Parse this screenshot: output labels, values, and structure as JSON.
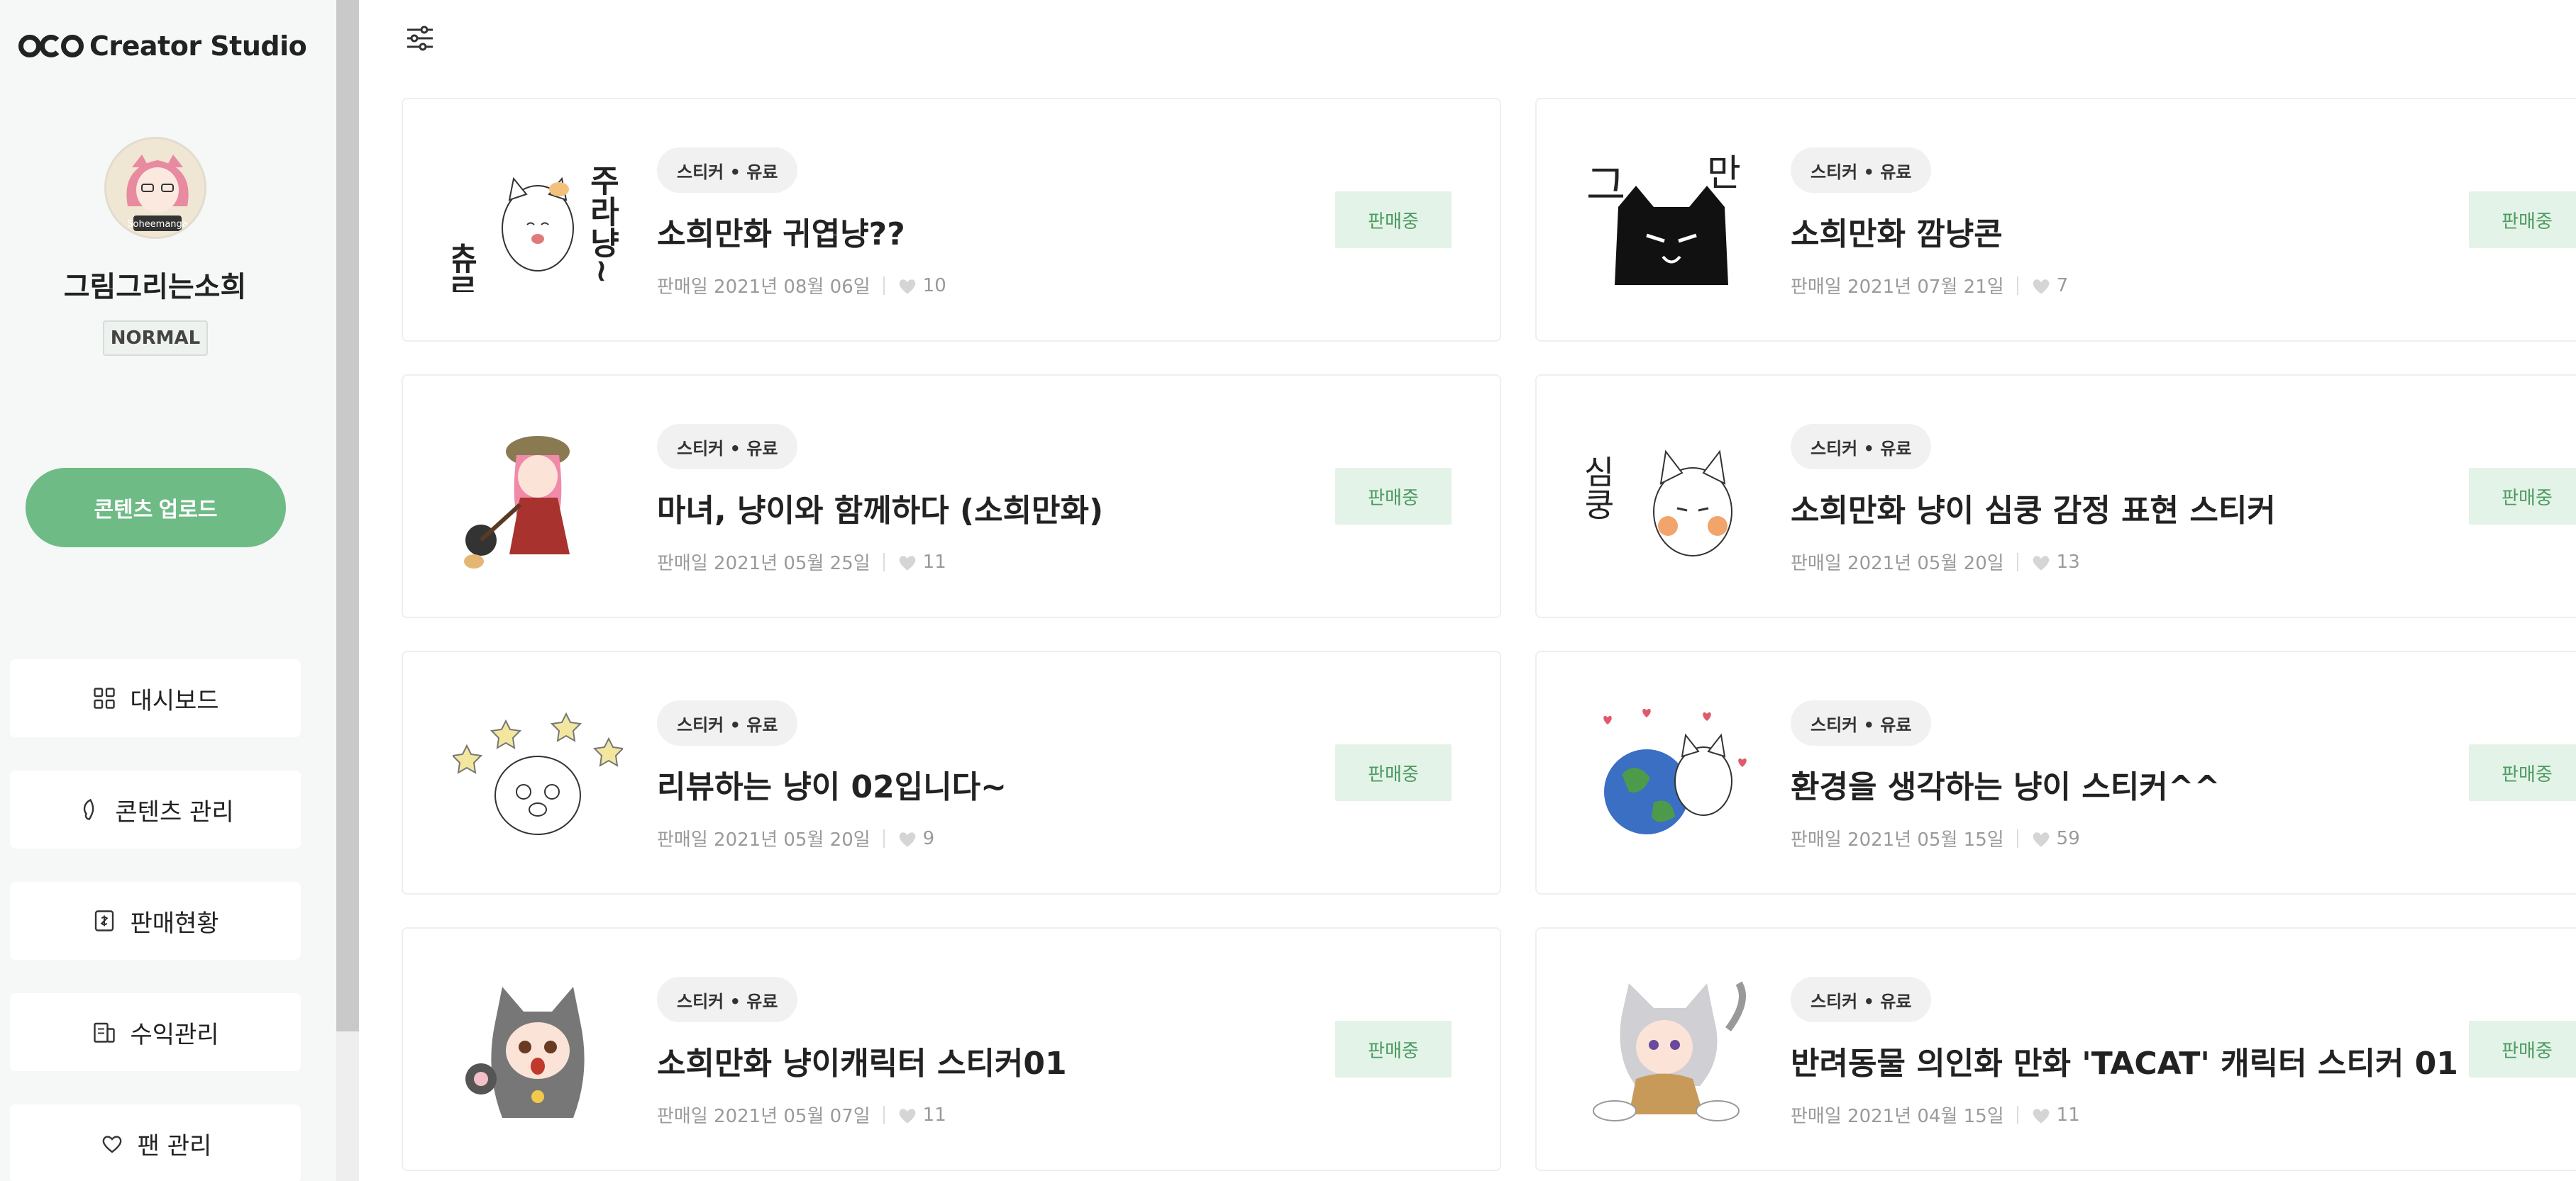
{
  "app": {
    "logo_text": "Creator Studio"
  },
  "profile": {
    "name": "그림그리는소희",
    "tier": "NORMAL",
    "avatar_caption": "Soheemanga"
  },
  "sidebar": {
    "upload_label": "콘텐츠 업로드",
    "items": [
      {
        "label": "대시보드",
        "icon": "grid-icon"
      },
      {
        "label": "콘텐츠 관리",
        "icon": "leaf-icon"
      },
      {
        "label": "판매현황",
        "icon": "sales-icon"
      },
      {
        "label": "수익관리",
        "icon": "ledger-icon"
      },
      {
        "label": "팬 관리",
        "icon": "heart-icon"
      }
    ]
  },
  "cards": [
    {
      "badge": "스티커 • 유료",
      "title": "소희만화 귀엽냥??",
      "date": "판매일 2021년 08월 06일",
      "likes": "10",
      "status": "판매중"
    },
    {
      "badge": "스티커 • 유료",
      "title": "소희만화 깜냥콘",
      "date": "판매일 2021년 07월 21일",
      "likes": "7",
      "status": "판매중"
    },
    {
      "badge": "스티커 • 유료",
      "title": "마녀, 냥이와 함께하다 (소희만화)",
      "date": "판매일 2021년 05월 25일",
      "likes": "11",
      "status": "판매중"
    },
    {
      "badge": "스티커 • 유료",
      "title": "소희만화 냥이 심쿵 감정 표현 스티커",
      "date": "판매일 2021년 05월 20일",
      "likes": "13",
      "status": "판매중"
    },
    {
      "badge": "스티커 • 유료",
      "title": "리뷰하는 냥이 02입니다~",
      "date": "판매일 2021년 05월 20일",
      "likes": "9",
      "status": "판매중"
    },
    {
      "badge": "스티커 • 유료",
      "title": "환경을 생각하는 냥이 스티커^^",
      "date": "판매일 2021년 05월 15일",
      "likes": "59",
      "status": "판매중"
    },
    {
      "badge": "스티커 • 유료",
      "title": "소희만화 냥이캐릭터 스티커01",
      "date": "판매일 2021년 05월 07일",
      "likes": "11",
      "status": "판매중"
    },
    {
      "badge": "스티커 • 유료",
      "title": "반려동물 의인화 만화 'TACAT' 캐릭터 스티커 01",
      "date": "판매일 2021년 04월 15일",
      "likes": "11",
      "status": "판매중"
    }
  ],
  "thumb_text": {
    "t0_left": "츄르",
    "t0_right": "주라냥~",
    "t1_left": "그",
    "t1_right": "만",
    "t3_left": "심쿵"
  }
}
